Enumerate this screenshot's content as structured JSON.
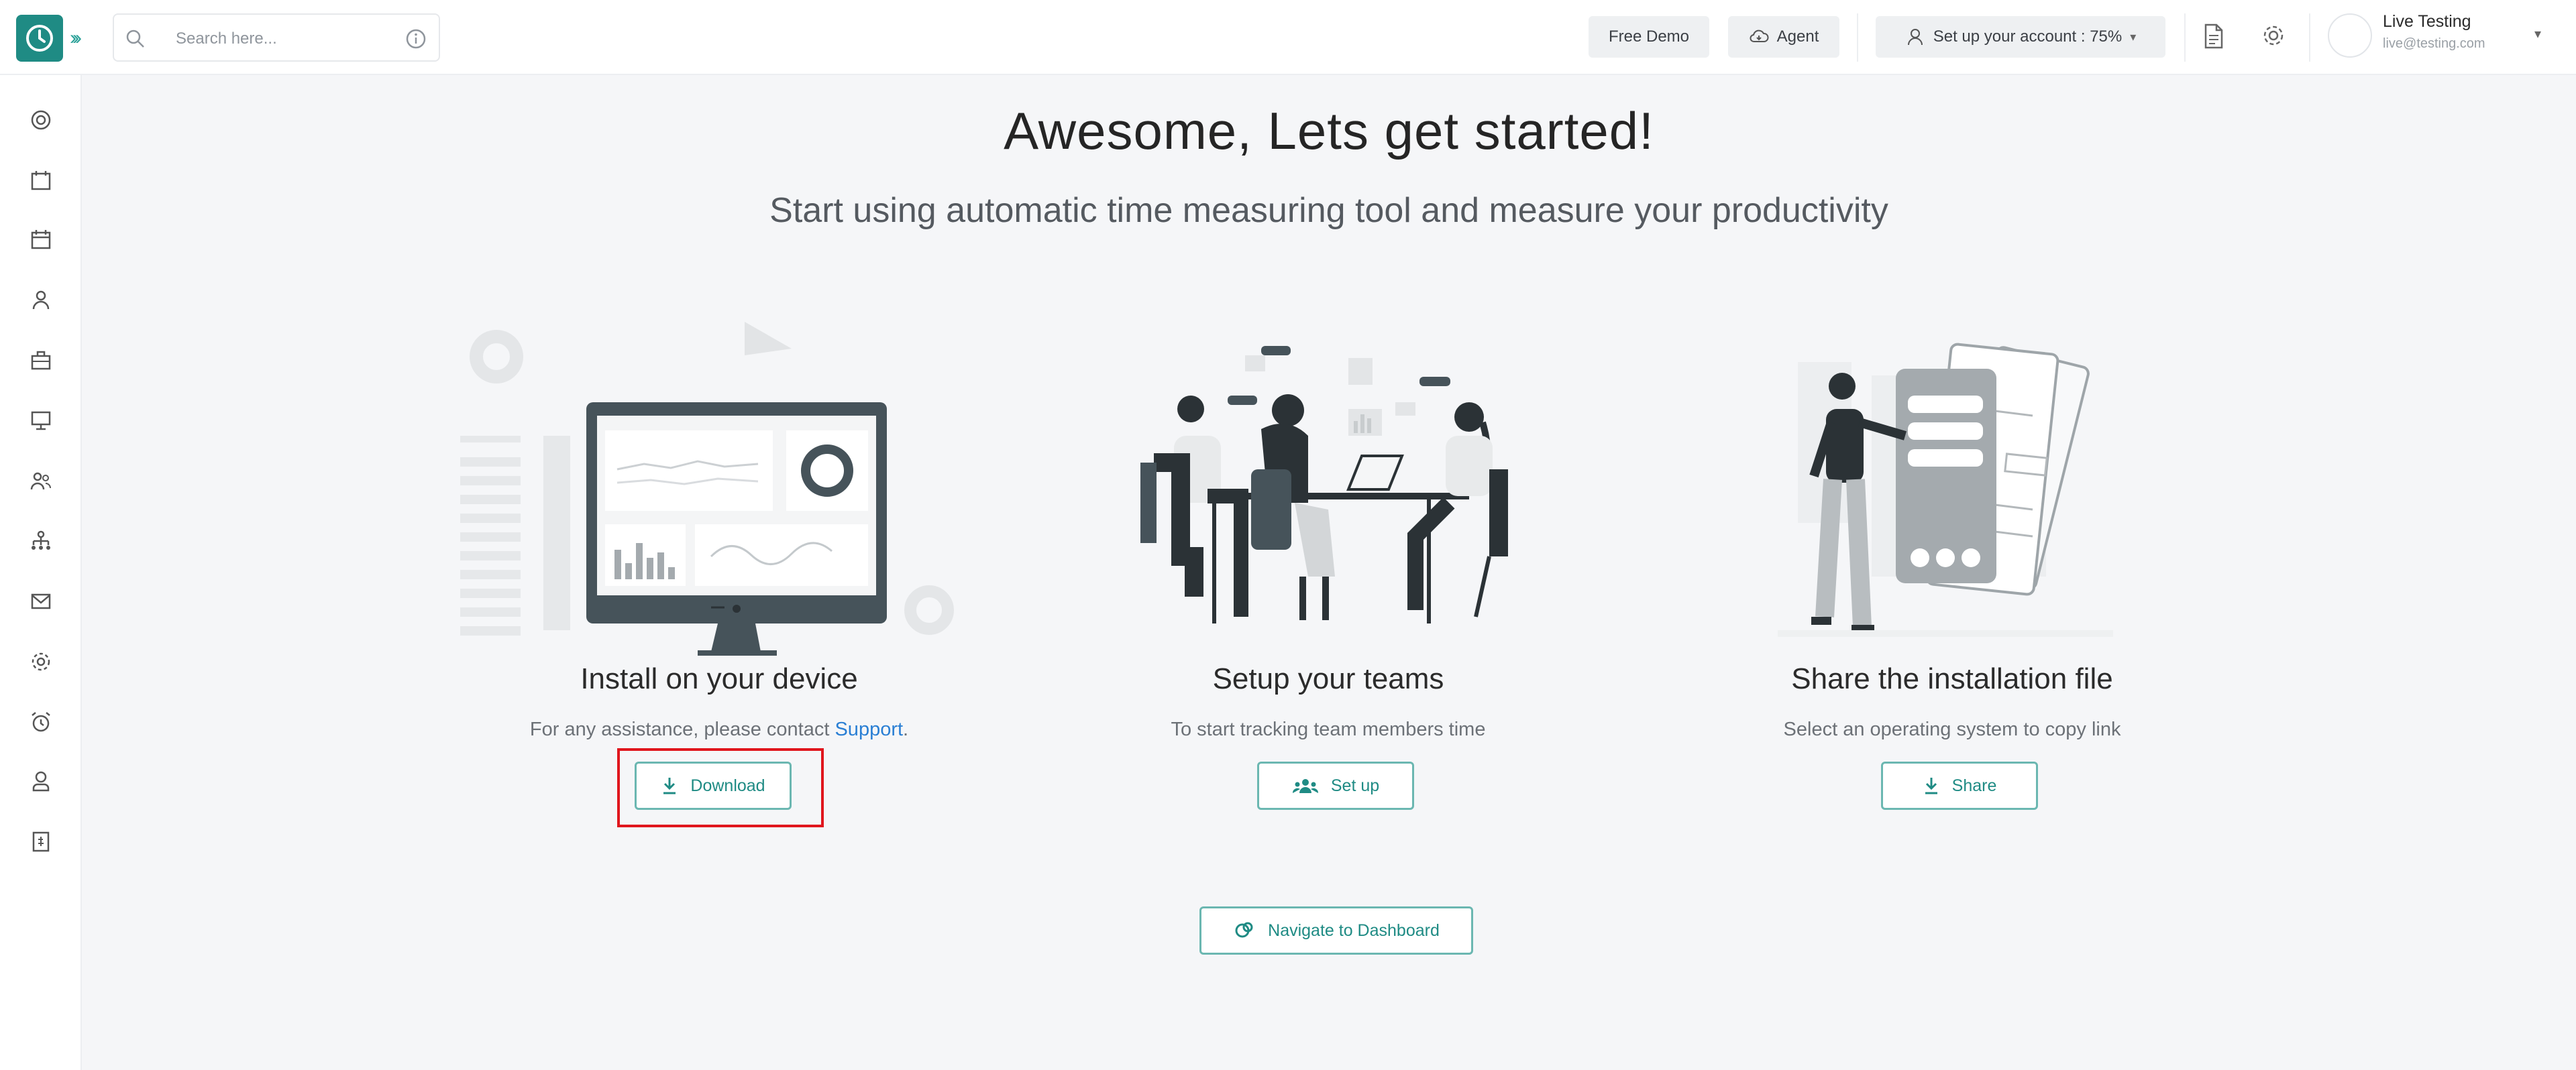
{
  "header": {
    "search_placeholder": "Search here...",
    "free_demo": "Free Demo",
    "agent": "Agent",
    "setup_account": "Set up your account : 75%",
    "user_name": "Live Testing",
    "user_email": "live@testing.com"
  },
  "sidebar": {
    "icons": [
      "dashboard-icon",
      "calendar-icon",
      "schedule-icon",
      "user-icon",
      "briefcase-icon",
      "monitor-icon",
      "team-icon",
      "org-chart-icon",
      "mail-icon",
      "settings-icon",
      "alarm-icon",
      "profile-icon",
      "report-icon"
    ]
  },
  "main": {
    "title": "Awesome, Lets get started!",
    "subtitle": "Start using automatic time measuring tool and measure your productivity",
    "cards": [
      {
        "title": "Install on your device",
        "desc": "For any assistance, please contact ",
        "link": "Support",
        "desc_end": ".",
        "button": "Download"
      },
      {
        "title": "Setup your teams",
        "desc": "To start tracking team members time",
        "button": "Set up"
      },
      {
        "title": "Share the installation file",
        "desc": "Select an operating system to copy link",
        "button": "Share"
      }
    ],
    "navigate_button": "Navigate to Dashboard"
  },
  "colors": {
    "accent": "#1f8b84",
    "highlight": "#e0161d",
    "link": "#2a7fd4"
  }
}
